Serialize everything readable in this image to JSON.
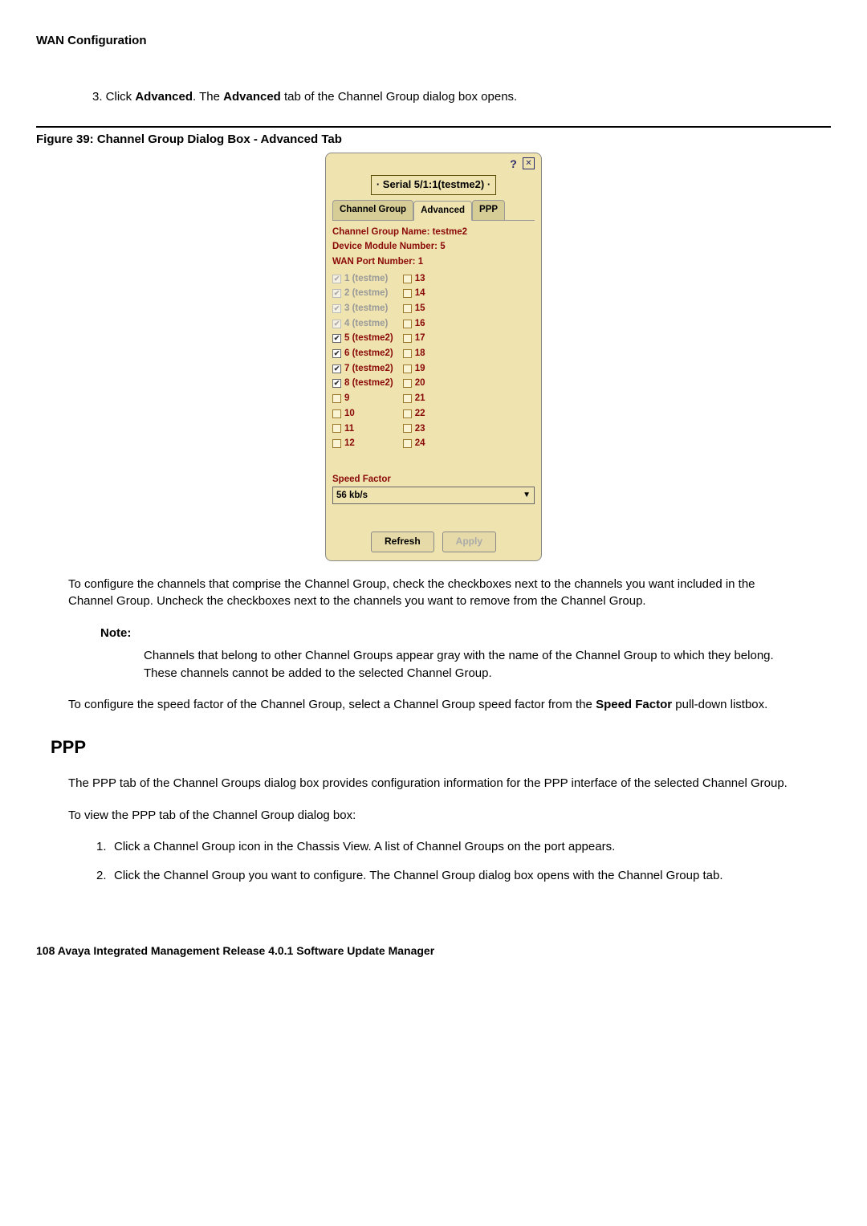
{
  "header": "WAN Configuration",
  "step3_pre": "3. Click ",
  "step3_b1": "Advanced",
  "step3_mid": ". The ",
  "step3_b2": "Advanced",
  "step3_post": " tab of the Channel Group dialog box opens.",
  "fig_caption": "Figure 39: Channel Group Dialog Box - Advanced Tab",
  "dialog": {
    "serial": "· Serial 5/1:1(testme2) ·",
    "tabs": {
      "t1": "Channel Group",
      "t2": "Advanced",
      "t3": "PPP"
    },
    "info1": "Channel Group Name: testme2",
    "info2": "Device Module Number: 5",
    "info3": "WAN Port Number: 1",
    "left": [
      {
        "n": "1",
        "suffix": "(testme)",
        "cls": "disabled",
        "checked": true
      },
      {
        "n": "2",
        "suffix": "(testme)",
        "cls": "disabled",
        "checked": true
      },
      {
        "n": "3",
        "suffix": "(testme)",
        "cls": "disabled",
        "checked": true
      },
      {
        "n": "4",
        "suffix": "(testme)",
        "cls": "disabled",
        "checked": true
      },
      {
        "n": "5",
        "suffix": "(testme2)",
        "cls": "active",
        "checked": true
      },
      {
        "n": "6",
        "suffix": "(testme2)",
        "cls": "active",
        "checked": true
      },
      {
        "n": "7",
        "suffix": "(testme2)",
        "cls": "active",
        "checked": true
      },
      {
        "n": "8",
        "suffix": "(testme2)",
        "cls": "active",
        "checked": true
      },
      {
        "n": "9",
        "suffix": "",
        "cls": "active",
        "checked": false
      },
      {
        "n": "10",
        "suffix": "",
        "cls": "active",
        "checked": false
      },
      {
        "n": "11",
        "suffix": "",
        "cls": "active",
        "checked": false
      },
      {
        "n": "12",
        "suffix": "",
        "cls": "active",
        "checked": false
      }
    ],
    "right": [
      {
        "n": "13",
        "checked": false
      },
      {
        "n": "14",
        "checked": false
      },
      {
        "n": "15",
        "checked": false
      },
      {
        "n": "16",
        "checked": false
      },
      {
        "n": "17",
        "checked": false
      },
      {
        "n": "18",
        "checked": false
      },
      {
        "n": "19",
        "checked": false
      },
      {
        "n": "20",
        "checked": false
      },
      {
        "n": "21",
        "checked": false
      },
      {
        "n": "22",
        "checked": false
      },
      {
        "n": "23",
        "checked": false
      },
      {
        "n": "24",
        "checked": false
      }
    ],
    "sf_label": "Speed Factor",
    "sf_value": "56 kb/s",
    "btn_refresh": "Refresh",
    "btn_apply": "Apply"
  },
  "para1": "To configure the channels that comprise the Channel Group, check the checkboxes next to the channels you want included in the Channel Group. Uncheck the checkboxes next to the channels you want to remove from the Channel Group.",
  "note_label": "Note:",
  "note_text": "Channels that belong to other Channel Groups appear gray with the name of the Channel Group to which they belong. These channels cannot be added to the selected Channel Group.",
  "para2_pre": "To configure the speed factor of the Channel Group, select a Channel Group speed factor from the ",
  "para2_b": "Speed Factor",
  "para2_post": " pull-down listbox.",
  "ppp_heading": "PPP",
  "para3": "The PPP tab of the Channel Groups dialog box provides configuration information for the PPP interface of the selected Channel Group.",
  "para4": "To view the PPP tab of the Channel Group dialog box:",
  "ol1_n": "1.",
  "ol1_t": "Click a Channel Group icon in the Chassis View. A list of Channel Groups on the port appears.",
  "ol2_n": "2.",
  "ol2_t": "Click the Channel Group you want to configure. The Channel Group dialog box opens with the Channel Group tab.",
  "footer": "108   Avaya Integrated Management Release 4.0.1 Software Update Manager"
}
